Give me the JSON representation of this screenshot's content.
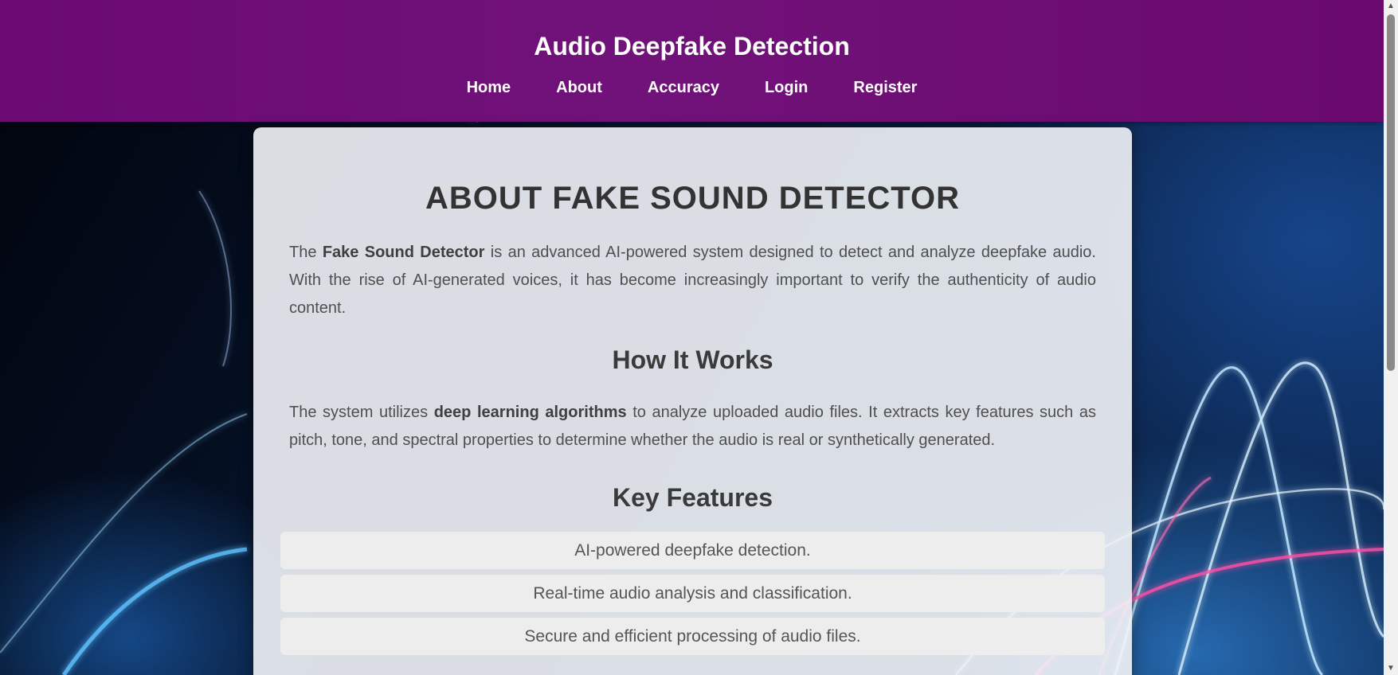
{
  "header": {
    "title": "Audio Deepfake Detection",
    "nav": [
      {
        "label": "Home"
      },
      {
        "label": "About"
      },
      {
        "label": "Accuracy"
      },
      {
        "label": "Login"
      },
      {
        "label": "Register"
      }
    ]
  },
  "main": {
    "title": "ABOUT FAKE SOUND DETECTOR",
    "intro": {
      "before": "The ",
      "bold": "Fake Sound Detector",
      "after": " is an advanced AI-powered system designed to detect and analyze deepfake audio. With the rise of AI-generated voices, it has become increasingly important to verify the authenticity of audio content."
    },
    "how_it_works": {
      "heading": "How It Works",
      "before": "The system utilizes ",
      "bold": "deep learning algorithms",
      "after": " to analyze uploaded audio files. It extracts key features such as pitch, tone, and spectral properties to determine whether the audio is real or synthetically generated."
    },
    "key_features": {
      "heading": "Key Features",
      "items": [
        "AI-powered deepfake detection.",
        "Real-time audio analysis and classification.",
        "Secure and efficient processing of audio files."
      ]
    }
  },
  "scrollbar": {
    "up_icon": "scroll-up-arrow-icon",
    "down_icon": "scroll-down-arrow-icon"
  }
}
